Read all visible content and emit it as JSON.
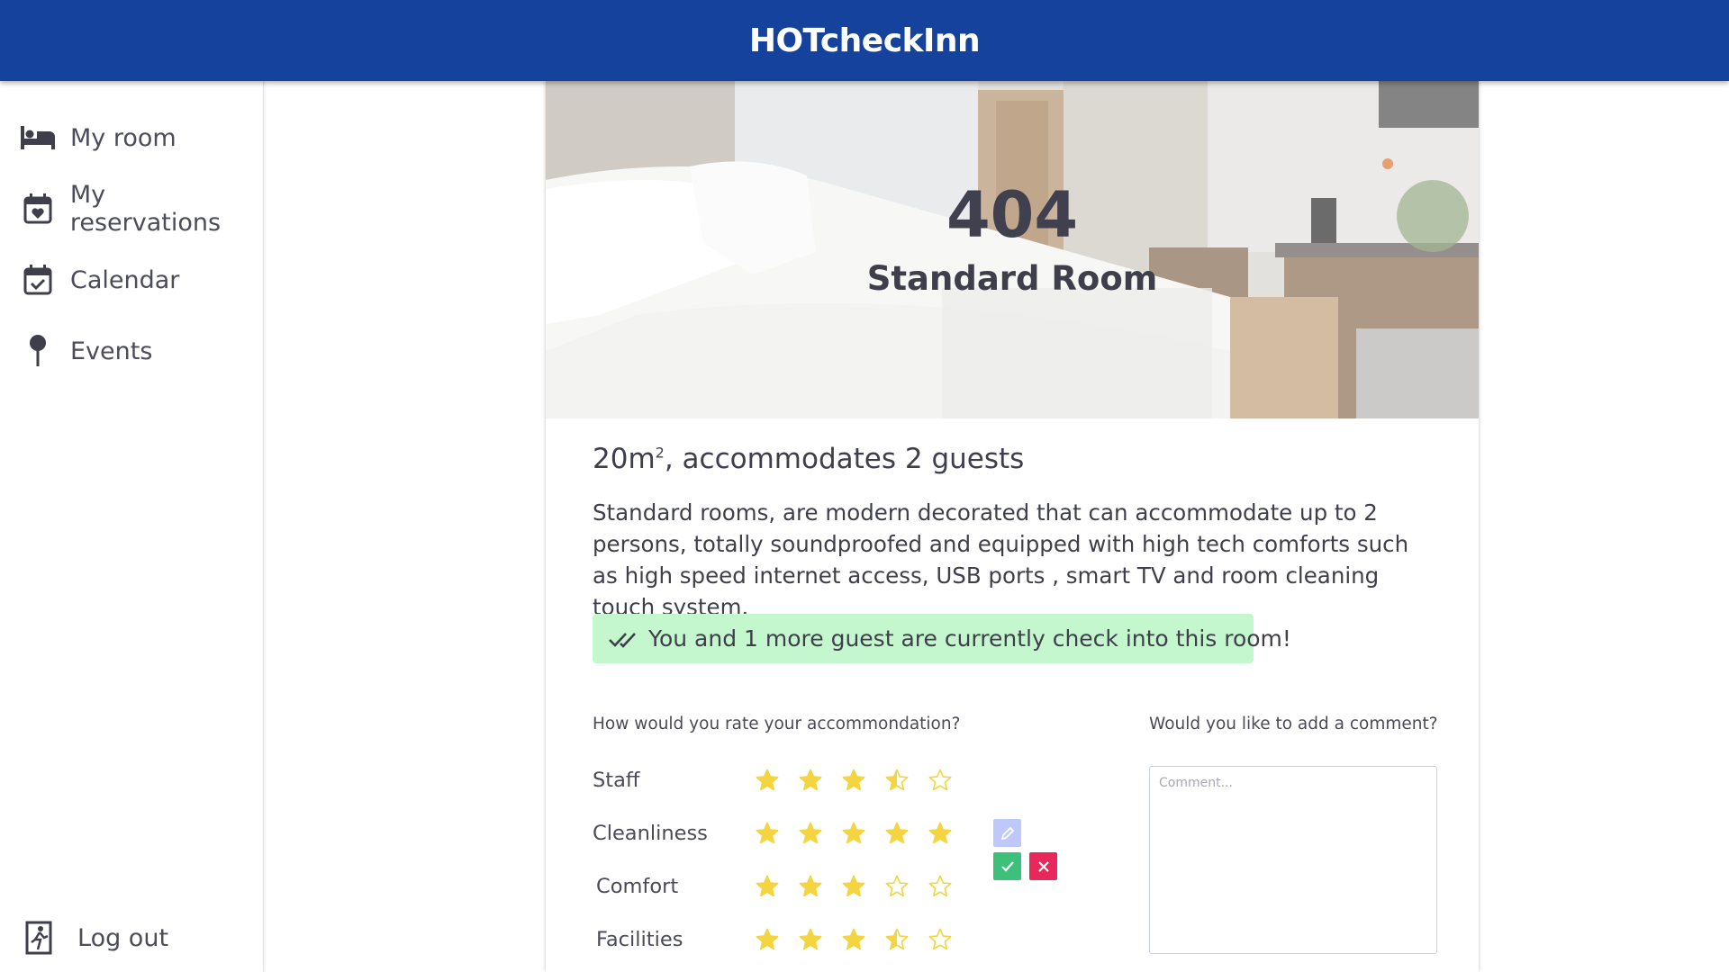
{
  "app": {
    "title": "HOTcheckInn"
  },
  "sidebar": {
    "items": [
      {
        "label": "My room",
        "icon": "bed-icon"
      },
      {
        "label": "My reservations",
        "icon": "calendar-heart-icon"
      },
      {
        "label": "Calendar",
        "icon": "calendar-check-icon"
      },
      {
        "label": "Events",
        "icon": "pin-icon"
      }
    ],
    "logout": {
      "label": "Log out",
      "icon": "exit-icon"
    }
  },
  "room": {
    "number": "404",
    "type": "Standard Room",
    "size": "20m",
    "size_sup": "2",
    "capacity": ", accommodates 2 guests",
    "description": "Standard rooms, are modern decorated that can accommodate up to 2 persons, totally soundproofed and equipped with high tech comforts such as high speed internet access, USB ports , smart TV and room cleaning touch system.",
    "checkin_status": "You and 1 more guest are currently check into this room!"
  },
  "rating": {
    "question": "How would you rate your accommondation?",
    "categories": [
      {
        "label": "Staff",
        "stars": 3.5
      },
      {
        "label": "Cleanliness",
        "stars": 5
      },
      {
        "label": "Comfort",
        "stars": 3
      },
      {
        "label": "Facilities",
        "stars": 3.5
      }
    ],
    "max_stars": 5
  },
  "comment": {
    "question": "Would you like to add a comment?",
    "placeholder": "Comment...",
    "value": ""
  },
  "colors": {
    "header": "#15429c",
    "star": "#f5d442",
    "banner": "#c4f7cd",
    "edit": "#bfc8fb",
    "confirm": "#3cc07a",
    "cancel": "#e8285a"
  }
}
